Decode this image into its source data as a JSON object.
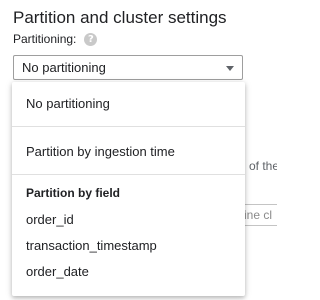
{
  "section": {
    "title": "Partition and cluster settings"
  },
  "partitioning": {
    "label": "Partitioning:",
    "help_icon": "help-circle-icon",
    "selected_value": "No partitioning",
    "caret_icon": "caret-down-icon"
  },
  "background": {
    "text_right_1": "of the",
    "input_right_placeholder": "ine cl"
  },
  "menu": {
    "options": [
      "No partitioning",
      "Partition by ingestion time"
    ],
    "group_label": "Partition by field",
    "fields": [
      "order_id",
      "transaction_timestamp",
      "order_date"
    ]
  }
}
